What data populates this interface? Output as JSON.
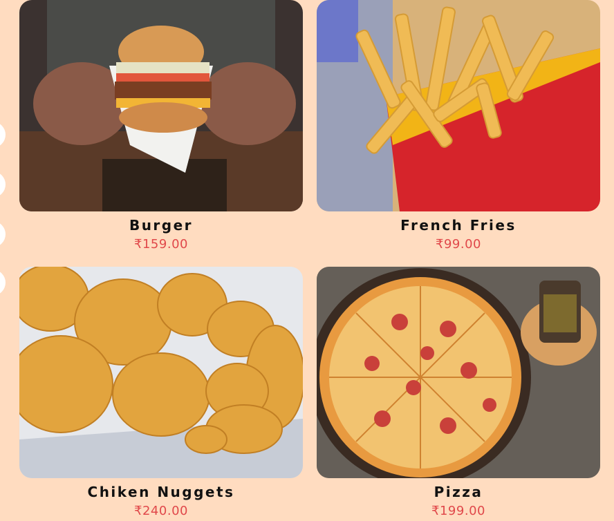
{
  "menu": {
    "items": [
      {
        "name": "Burger",
        "price": "159.00",
        "currency": "₹",
        "image_icon": "burger-photo"
      },
      {
        "name": "French Fries",
        "price": "99.00",
        "currency": "₹",
        "image_icon": "fries-photo"
      },
      {
        "name": "Chiken Nuggets",
        "price": "240.00",
        "currency": "₹",
        "image_icon": "nuggets-photo"
      },
      {
        "name": "Pizza",
        "price": "199.00",
        "currency": "₹",
        "image_icon": "pizza-photo"
      }
    ]
  },
  "colors": {
    "background": "#FFDCC0",
    "price": "#E0484A",
    "title": "#111111"
  }
}
